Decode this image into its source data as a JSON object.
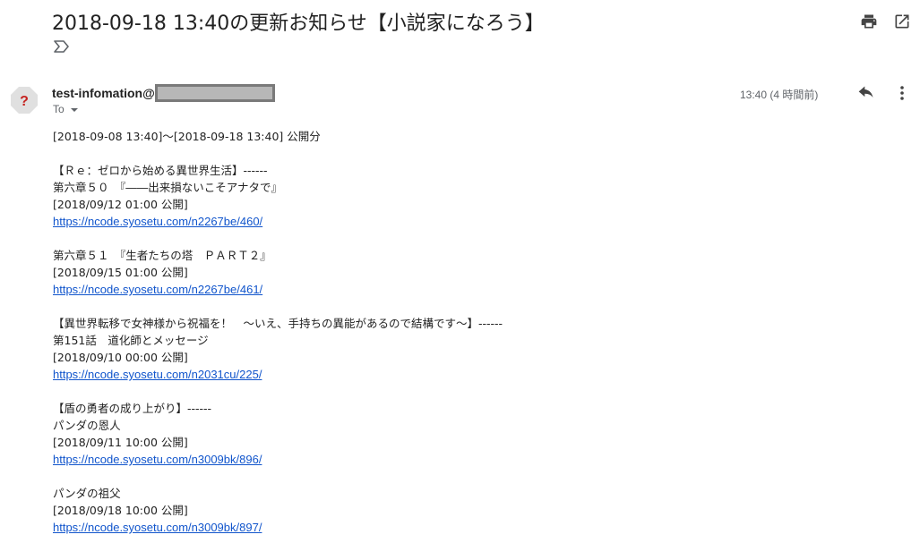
{
  "email": {
    "subject": "2018-09-18 13:40の更新お知らせ【小説家になろう】",
    "sender_name": "test-infomation@",
    "to_label": "To",
    "time": "13:40 (4 時間前)"
  },
  "icons": {
    "label": "label-arrow-icon",
    "print": "print-icon",
    "open_new_window": "open-in-new-icon",
    "avatar": "unknown-sender-avatar-icon",
    "reply": "reply-icon",
    "more": "more-vertical-icon"
  },
  "colors": {
    "link": "#1155cc",
    "avatar_bg": "#e0e0e0",
    "avatar_mark": "#c5221f",
    "meta_text": "#5f6368"
  },
  "body_lines": [
    {
      "type": "text",
      "text": "[2018-09-08 13:40]〜[2018-09-18 13:40] 公開分"
    },
    {
      "type": "blank",
      "text": ""
    },
    {
      "type": "text",
      "text": "【Ｒｅ：ゼロから始める異世界生活】------"
    },
    {
      "type": "text",
      "text": "第六章５０　『――出来損ないこそアナタで』"
    },
    {
      "type": "text",
      "text": "[2018/09/12 01:00 公開]"
    },
    {
      "type": "link",
      "text": "https://ncode.syosetu.com/n2267be/460/"
    },
    {
      "type": "blank",
      "text": ""
    },
    {
      "type": "text",
      "text": "第六章５１　『生者たちの塔　ＰＡＲＴ２』"
    },
    {
      "type": "text",
      "text": "[2018/09/15 01:00 公開]"
    },
    {
      "type": "link",
      "text": "https://ncode.syosetu.com/n2267be/461/"
    },
    {
      "type": "blank",
      "text": ""
    },
    {
      "type": "text",
      "text": "【異世界転移で女神様から祝福を！　〜いえ、手持ちの異能があるので結構です〜】------"
    },
    {
      "type": "text",
      "text": "第151話　道化師とメッセージ"
    },
    {
      "type": "text",
      "text": "[2018/09/10 00:00 公開]"
    },
    {
      "type": "link",
      "text": "https://ncode.syosetu.com/n2031cu/225/"
    },
    {
      "type": "blank",
      "text": ""
    },
    {
      "type": "text",
      "text": "【盾の勇者の成り上がり】------"
    },
    {
      "type": "text",
      "text": "パンダの恩人"
    },
    {
      "type": "text",
      "text": "[2018/09/11 10:00 公開]"
    },
    {
      "type": "link",
      "text": "https://ncode.syosetu.com/n3009bk/896/"
    },
    {
      "type": "blank",
      "text": ""
    },
    {
      "type": "text",
      "text": "パンダの祖父"
    },
    {
      "type": "text",
      "text": "[2018/09/18 10:00 公開]"
    },
    {
      "type": "link",
      "text": "https://ncode.syosetu.com/n3009bk/897/"
    }
  ]
}
